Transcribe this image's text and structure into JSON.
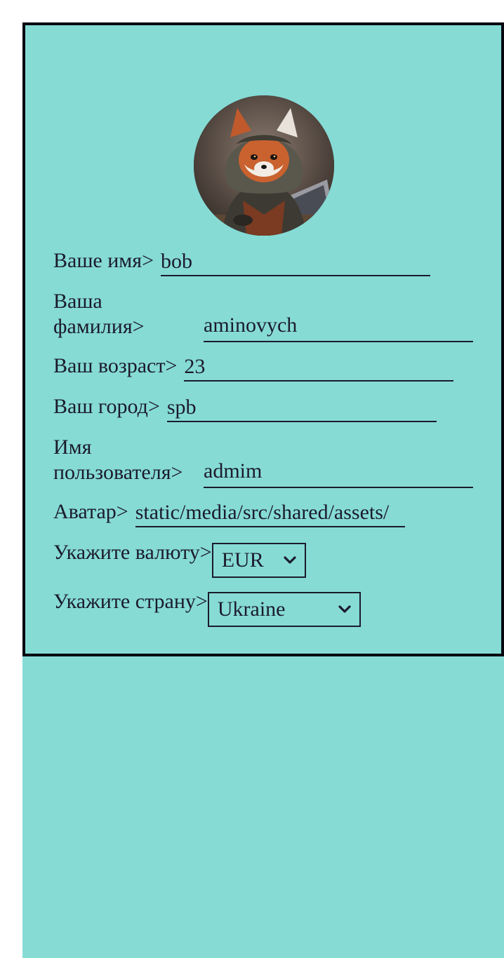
{
  "profile": {
    "avatar_icon": "fox-hacker-avatar",
    "name": {
      "label": "Ваше имя>",
      "value": "bob"
    },
    "surname": {
      "label": "Ваша\nфамилия>",
      "value": "aminovych"
    },
    "age": {
      "label": "Ваш возраст>",
      "value": "23"
    },
    "city": {
      "label": "Ваш город>",
      "value": "spb"
    },
    "username": {
      "label": "Имя\nпользователя>",
      "value": "admim"
    },
    "avatar_path": {
      "label": "Аватар>",
      "value": "static/media/src/shared/assets/"
    },
    "currency": {
      "label": "Укажите валюту>",
      "value": "EUR"
    },
    "country": {
      "label": "Укажите страну>",
      "value": "Ukraine"
    }
  },
  "colors": {
    "background": "#86dbd5",
    "border": "#050810",
    "text": "#1b1b2b"
  }
}
